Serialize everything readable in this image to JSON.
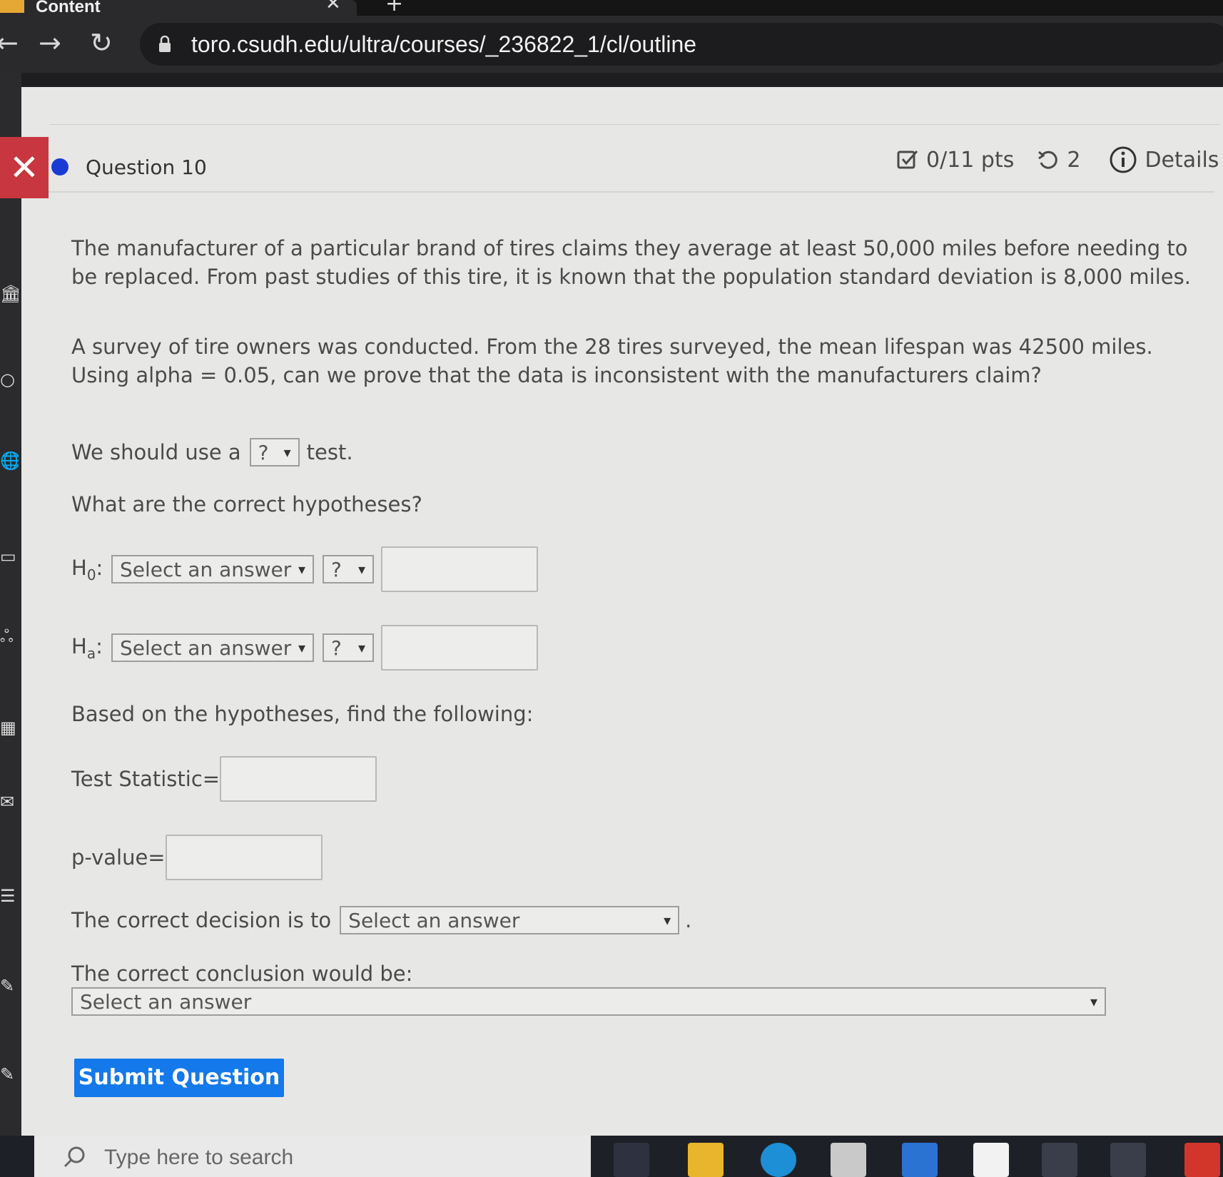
{
  "browser": {
    "tab_title": "Content",
    "url": "toro.csudh.edu/ultra/courses/_236822_1/cl/outline"
  },
  "question": {
    "title": "Question 10",
    "points": "0/11 pts",
    "attempts": "2",
    "details_label": "Details",
    "paragraph1": "The manufacturer of a particular brand of tires claims they average at least 50,000 miles before needing to be replaced. From past studies of this tire, it is known that the population standard deviation is 8,000 miles.",
    "paragraph2": "A survey of tire owners was conducted. From the 28 tires surveyed, the mean lifespan was 42500 miles. Using alpha = 0.05, can we prove that the data is inconsistent with the manufacturers claim?",
    "test_prefix": "We should use a",
    "test_select": "?",
    "test_suffix": "test.",
    "hypotheses_prompt": "What are the correct hypotheses?",
    "h0": {
      "letter": "H",
      "sub": "0",
      "colon": ":",
      "param_select": "Select an answer",
      "op_select": "?"
    },
    "ha": {
      "letter": "H",
      "sub": "a",
      "colon": ":",
      "param_select": "Select an answer",
      "op_select": "?"
    },
    "find_prompt": "Based on the hypotheses, find the following:",
    "test_statistic_label": "Test Statistic=",
    "p_value_label": "p-value=",
    "decision_prefix": "The correct decision is to",
    "decision_select": "Select an answer",
    "conclusion_label": "The correct conclusion would be:",
    "conclusion_select": "Select an answer",
    "submit_label": "Submit Question"
  },
  "taskbar": {
    "search_placeholder": "Type here to search"
  }
}
